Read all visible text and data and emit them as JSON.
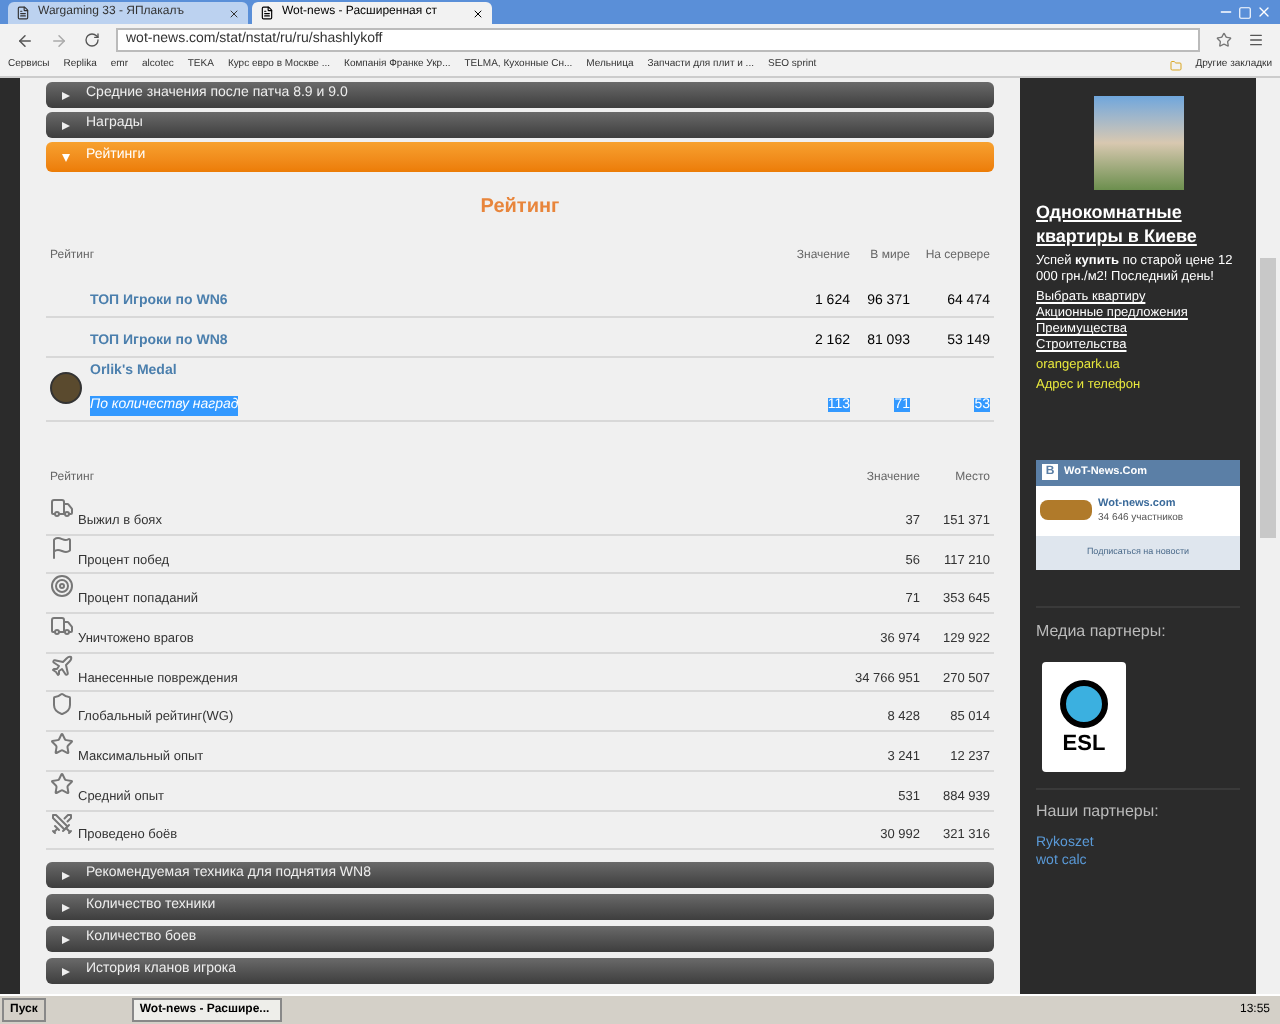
{
  "browser": {
    "tabs": [
      {
        "title": "Wargaming 33 - ЯПлакалъ",
        "selected": false
      },
      {
        "title": "Wot-news - Расширенная ст",
        "selected": true
      }
    ],
    "url": "wot-news.com/stat/nstat/ru/ru/shashlykoff",
    "bookmarks": [
      "Сервисы",
      "Replika",
      "emr",
      "alcotec",
      "TEKA",
      "Курс евро в Москве ...",
      "Компанія Франке Укр...",
      "TELMA, Кухонные Сн...",
      "Мельница",
      "Запчасти для плит и ...",
      "SEO sprint"
    ],
    "other_bookmarks": "Другие закладки"
  },
  "sections_top": [
    {
      "label": "Средние значения после патча 8.9 и 9.0",
      "expanded": false
    },
    {
      "label": "Награды",
      "expanded": false
    },
    {
      "label": "Рейтинги",
      "expanded": true
    }
  ],
  "rating": {
    "title": "Рейтинг",
    "columns": [
      "Рейтинг",
      "Значение",
      "В мире",
      "На сервере"
    ],
    "rows": [
      {
        "name": "ТОП Игроки по WN6",
        "value": "1 624",
        "world": "96 371",
        "server": "64 474"
      },
      {
        "name": "ТОП Игроки по WN8",
        "value": "2 162",
        "world": "81 093",
        "server": "53 149"
      }
    ],
    "medal": {
      "name": "Orlik's Medal",
      "subtitle": "По количеству наград",
      "value": "113",
      "world": "71",
      "server": "53",
      "selected": true
    }
  },
  "stats": {
    "columns": [
      "Рейтинг",
      "Значение",
      "Место"
    ],
    "rows": [
      {
        "kind": "tank",
        "name": "Выжил в боях",
        "value": "37",
        "place": "151 371"
      },
      {
        "kind": "flag",
        "name": "Процент побед",
        "value": "56",
        "place": "117 210"
      },
      {
        "kind": "target",
        "name": "Процент попаданий",
        "value": "71",
        "place": "353 645"
      },
      {
        "kind": "tank",
        "name": "Уничтожено врагов",
        "value": "36 974",
        "place": "129 922"
      },
      {
        "kind": "plane",
        "name": "Нанесенные повреждения",
        "value": "34 766 951",
        "place": "270 507"
      },
      {
        "kind": "shield",
        "name": "Глобальный рейтинг(WG)",
        "value": "8 428",
        "place": "85 014"
      },
      {
        "kind": "star",
        "name": "Максимальный опыт",
        "value": "3 241",
        "place": "12 237"
      },
      {
        "kind": "star",
        "name": "Средний опыт",
        "value": "531",
        "place": "884 939"
      },
      {
        "kind": "swords",
        "name": "Проведено боёв",
        "value": "30 992",
        "place": "321 316"
      }
    ]
  },
  "sections_bottom": [
    {
      "label": "Рекомендуемая техника для поднятия WN8",
      "expanded": false
    },
    {
      "label": "Количество техники",
      "expanded": false
    },
    {
      "label": "Количество боев",
      "expanded": false
    },
    {
      "label": "История кланов игрока",
      "expanded": false
    }
  ],
  "sidebar": {
    "ad": {
      "title": "Однокомнатные квартиры в Киеве",
      "text": "Успей **купить** по старой цене 12 000 грн./м2! Последний день!",
      "links": [
        "Выбрать квартиру",
        "Акционные предложения",
        "Преимущества",
        "Строительства"
      ],
      "site": "orangepark.ua",
      "address": "Адрес и телефон"
    },
    "vk": {
      "logo": "B",
      "title": "WoT-News.Com",
      "name": "Wot-news.com",
      "members": "34 646 участников",
      "subscribe": "Подписаться на новости"
    },
    "media_title": "Медиа партнеры:",
    "esl": "ESL",
    "partners_title": "Наши партнеры:",
    "partners": [
      "Rykoszet",
      "wot calc"
    ]
  },
  "taskbar": {
    "start": "Пуск",
    "window": "Wot-news - Расшире...",
    "clock": "13:55"
  }
}
